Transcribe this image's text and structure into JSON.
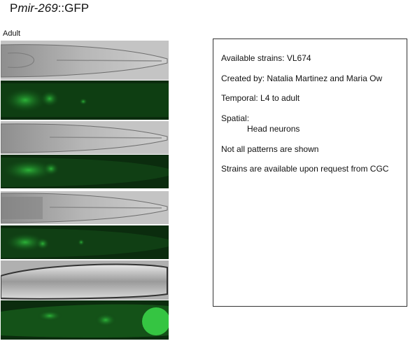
{
  "header": {
    "title_prefix": "P",
    "title_gene": "mir-269",
    "title_suffix": "::GFP",
    "stage_label": "Adult"
  },
  "info": {
    "strains": "Available strains: VL674",
    "created": "Created by: Natalia Martinez and Maria Ow",
    "temporal": "Temporal: L4 to adult",
    "spatial_label": "Spatial:",
    "spatial_value": "Head neurons",
    "note": "Not all patterns are shown",
    "availability": "Strains are available upon request from CGC"
  },
  "colors": {
    "gfp_bright": "#3bd94a",
    "gfp_dark": "#0c3a10",
    "brightfield": "#b5b5b5",
    "border": "#333333"
  }
}
